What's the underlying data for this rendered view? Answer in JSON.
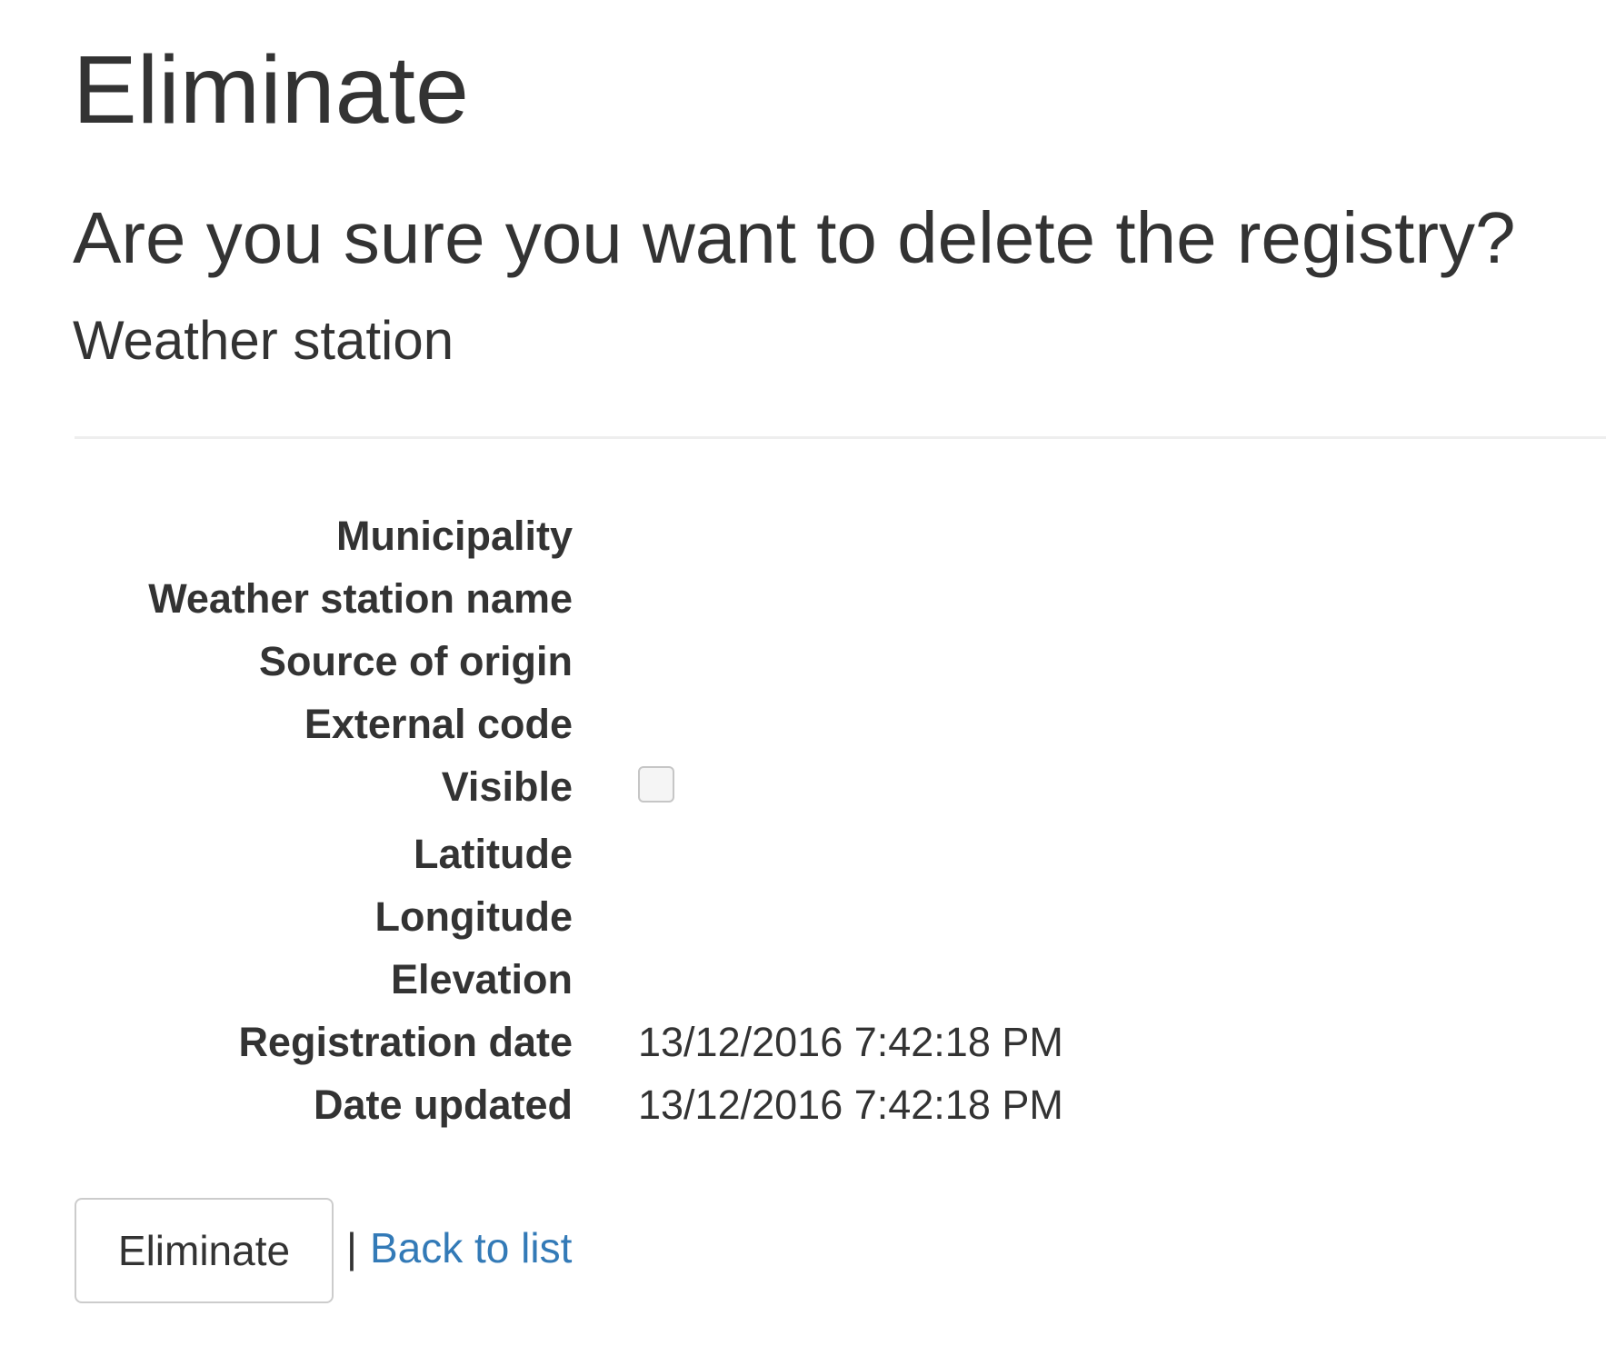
{
  "page": {
    "title": "Eliminate",
    "confirm_question": "Are you sure you want to delete the registry?",
    "entity_name": "Weather station"
  },
  "details": {
    "municipality": {
      "label": "Municipality",
      "value": ""
    },
    "weather_station_name": {
      "label": "Weather station name",
      "value": ""
    },
    "source_of_origin": {
      "label": "Source of origin",
      "value": ""
    },
    "external_code": {
      "label": "External code",
      "value": ""
    },
    "visible": {
      "label": "Visible",
      "checked": false
    },
    "latitude": {
      "label": "Latitude",
      "value": ""
    },
    "longitude": {
      "label": "Longitude",
      "value": ""
    },
    "elevation": {
      "label": "Elevation",
      "value": ""
    },
    "registration_date": {
      "label": "Registration date",
      "value": "13/12/2016 7:42:18 PM"
    },
    "date_updated": {
      "label": "Date updated",
      "value": "13/12/2016 7:42:18 PM"
    }
  },
  "actions": {
    "eliminate_label": "Eliminate",
    "separator": "|",
    "back_to_list_label": "Back to list"
  },
  "colors": {
    "text": "#333333",
    "link": "#337ab7",
    "divider": "#eeeeee",
    "button_border": "#cccccc"
  }
}
